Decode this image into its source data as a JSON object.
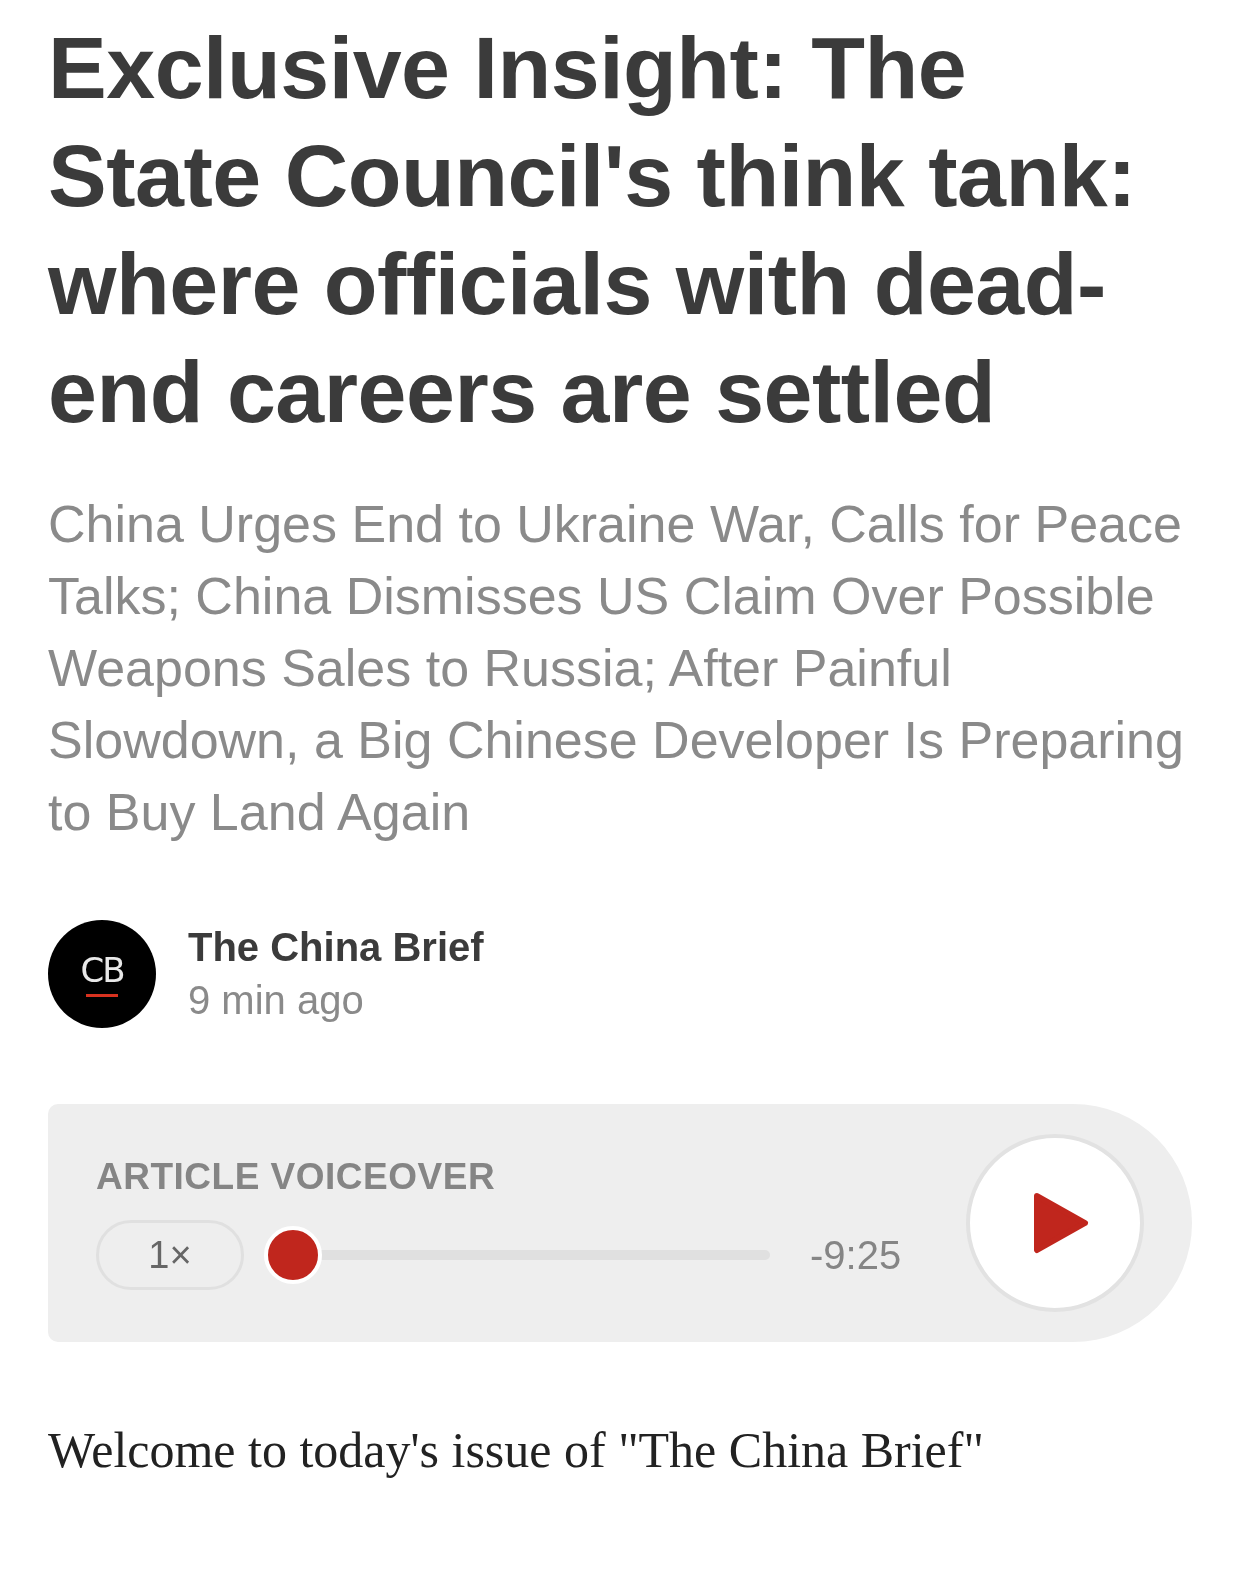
{
  "headline": "Exclusive Insight: The State Council's think tank: where officials with dead-end careers are settled",
  "dek": "China Urges End to Ukraine War, Calls for Peace Talks; China Dismisses US Claim Over Possible Weapons Sales to Russia; After Painful Slowdown, a Big Chinese Developer Is Preparing to Buy Land Again",
  "author": {
    "logo_text": "CB",
    "name": "The China Brief",
    "time": "9 min ago"
  },
  "voiceover": {
    "label": "ARTICLE VOICEOVER",
    "speed": "1×",
    "level": 0,
    "remaining": "-9:25"
  },
  "body": "Welcome to today's issue of \"The China Brief\""
}
